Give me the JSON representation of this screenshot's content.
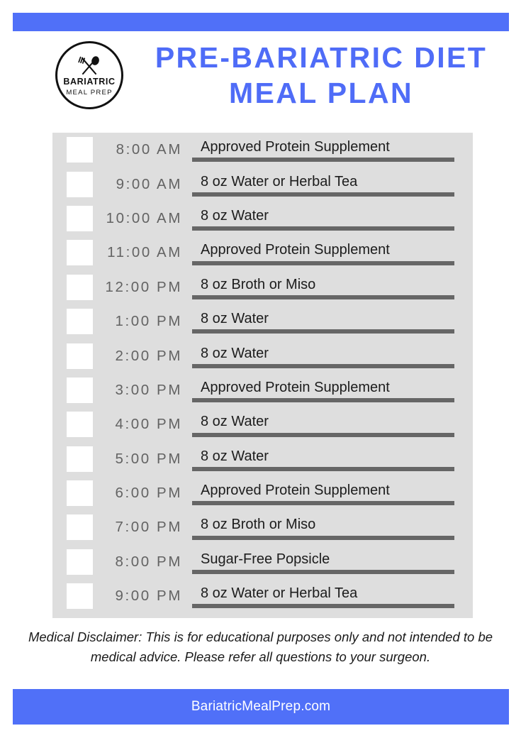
{
  "colors": {
    "accent": "#5070f8",
    "title": "#4f6cf7",
    "panel_bg": "#dedede",
    "rule": "#666666",
    "time_text": "#636363",
    "entry_text": "#1c1c1c"
  },
  "logo": {
    "name": "BARIATRIC",
    "sub": "MEAL PREP",
    "icon": "fork-and-spoon-icon"
  },
  "header": {
    "title_line1": "PRE-BARIATRIC DIET",
    "title_line2": "MEAL PLAN"
  },
  "schedule": {
    "rows": [
      {
        "time": "8:00 AM",
        "entry": "Approved Protein Supplement",
        "checked": false
      },
      {
        "time": "9:00 AM",
        "entry": "8 oz Water or Herbal Tea",
        "checked": false
      },
      {
        "time": "10:00 AM",
        "entry": "8 oz Water",
        "checked": false
      },
      {
        "time": "11:00 AM",
        "entry": "Approved Protein Supplement",
        "checked": false
      },
      {
        "time": "12:00 PM",
        "entry": "8 oz Broth or Miso",
        "checked": false
      },
      {
        "time": "1:00 PM",
        "entry": "8 oz Water",
        "checked": false
      },
      {
        "time": "2:00 PM",
        "entry": "8 oz Water",
        "checked": false
      },
      {
        "time": "3:00 PM",
        "entry": "Approved Protein Supplement",
        "checked": false
      },
      {
        "time": "4:00 PM",
        "entry": "8 oz Water",
        "checked": false
      },
      {
        "time": "5:00 PM",
        "entry": "8 oz Water",
        "checked": false
      },
      {
        "time": "6:00 PM",
        "entry": "Approved Protein Supplement",
        "checked": false
      },
      {
        "time": "7:00 PM",
        "entry": "8 oz Broth or Miso",
        "checked": false
      },
      {
        "time": "8:00 PM",
        "entry": "Sugar-Free Popsicle",
        "checked": false
      },
      {
        "time": "9:00 PM",
        "entry": "8 oz Water or Herbal Tea",
        "checked": false
      }
    ]
  },
  "disclaimer": {
    "text": "Medical Disclaimer: This is for educational purposes only and not intended to be medical advice. Please refer all questions to your surgeon."
  },
  "footer": {
    "website": "BariatricMealPrep.com"
  }
}
